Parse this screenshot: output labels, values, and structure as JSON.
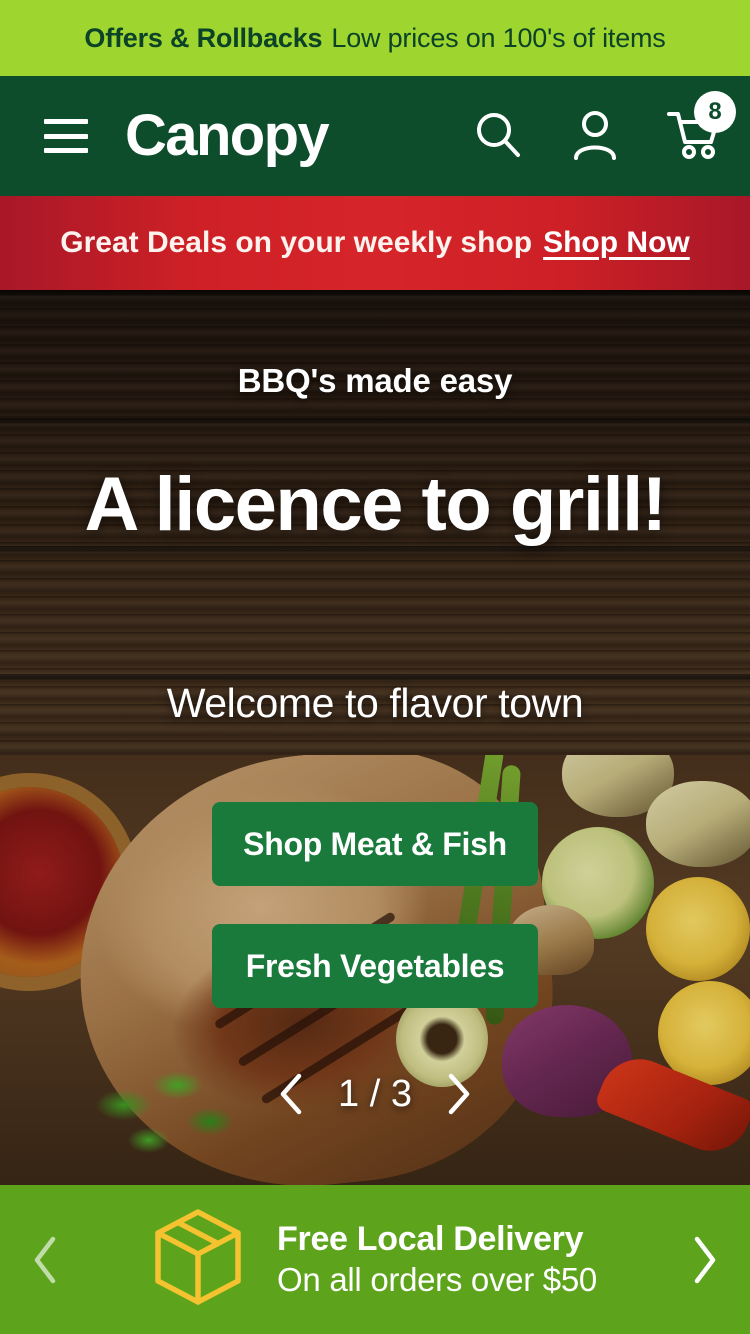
{
  "promo_strip": {
    "bold_text": "Offers & Rollbacks",
    "regular_text": "Low prices on 100's of items"
  },
  "header": {
    "brand": "Canopy",
    "menu_icon": "hamburger-menu-icon",
    "search_icon": "search-icon",
    "account_icon": "account-person-icon",
    "cart_icon": "shopping-cart-icon",
    "cart_count": "8",
    "background_color": "#0d4d2b"
  },
  "deal_bar": {
    "text": "Great Deals on your weekly shop",
    "link_label": "Shop Now",
    "background_color": "#cd2026"
  },
  "hero": {
    "eyebrow": "BBQ's made easy",
    "headline": "A licence to grill!",
    "subhead": "Welcome to flavor town",
    "buttons": [
      {
        "label": "Shop Meat & Fish"
      },
      {
        "label": "Fresh Vegetables"
      }
    ],
    "carousel": {
      "prev_icon": "chevron-left-icon",
      "next_icon": "chevron-right-icon",
      "position": "1 / 3"
    },
    "button_color": "#1a7a3c"
  },
  "delivery_bar": {
    "icon": "package-box-icon",
    "title": "Free Local Delivery",
    "subtitle": "On all orders over $50",
    "prev_icon": "chevron-left-icon",
    "next_icon": "chevron-right-icon",
    "background_color": "#5da41c",
    "icon_color": "#f5c230"
  }
}
